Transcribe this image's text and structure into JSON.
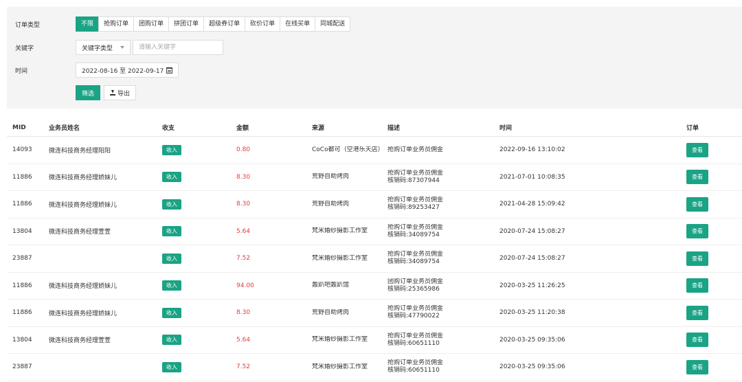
{
  "filters": {
    "order_type_label": "订单类型",
    "order_types": [
      "不限",
      "抢购订单",
      "团购订单",
      "拼团订单",
      "超级券订单",
      "砍价订单",
      "在线买单",
      "同城配送"
    ],
    "keyword_label": "关键字",
    "keyword_select": "关键字类型",
    "keyword_placeholder": "请输入关键字",
    "time_label": "时间",
    "date_range": "2022-08-16 至 2022-09-17",
    "filter_button": "筛选",
    "export_button": "导出"
  },
  "table": {
    "headers": [
      "MID",
      "业务员姓名",
      "收支",
      "金额",
      "来源",
      "描述",
      "时间",
      "订单"
    ],
    "view_label": "查看",
    "rows": [
      {
        "mid": "14093",
        "name": "微连科技商务经理阳阳",
        "type": "收入",
        "amount": "0.80",
        "source": "CoCo都可（空港乐天店）",
        "desc1": "抢购订单业务员佣金",
        "desc2": "",
        "time": "2022-09-16 13:10:02"
      },
      {
        "mid": "11886",
        "name": "微连科技商务经理娇妹儿",
        "type": "收入",
        "amount": "8.30",
        "source": "荒野自助烤肉",
        "desc1": "抢购订单业务员佣金",
        "desc2": "核销码:87307944",
        "time": "2021-07-01 10:08:35"
      },
      {
        "mid": "11886",
        "name": "微连科技商务经理娇妹儿",
        "type": "收入",
        "amount": "8.30",
        "source": "荒野自助烤肉",
        "desc1": "抢购订单业务员佣金",
        "desc2": "核销码:89253427",
        "time": "2021-04-28 15:09:42"
      },
      {
        "mid": "13804",
        "name": "微连科技商务经理萱萱",
        "type": "收入",
        "amount": "5.64",
        "source": "梵米婚纱摄影工作室",
        "desc1": "抢购订单业务员佣金",
        "desc2": "核销码:34089754",
        "time": "2020-07-24 15:08:27"
      },
      {
        "mid": "23887",
        "name": "",
        "type": "收入",
        "amount": "7.52",
        "source": "梵米婚纱摄影工作室",
        "desc1": "抢购订单业务员佣金",
        "desc2": "核销码:34089754",
        "time": "2020-07-24 15:08:27"
      },
      {
        "mid": "11886",
        "name": "微连科技商务经理娇妹儿",
        "type": "收入",
        "amount": "94.00",
        "source": "轰趴吧轰趴馆",
        "desc1": "团购订单业务员佣金",
        "desc2": "核销码:25365986",
        "time": "2020-03-25 11:26:25"
      },
      {
        "mid": "11886",
        "name": "微连科技商务经理娇妹儿",
        "type": "收入",
        "amount": "8.30",
        "source": "荒野自助烤肉",
        "desc1": "抢购订单业务员佣金",
        "desc2": "核销码:47790022",
        "time": "2020-03-25 11:20:38"
      },
      {
        "mid": "13804",
        "name": "微连科技商务经理萱萱",
        "type": "收入",
        "amount": "5.64",
        "source": "梵米婚纱摄影工作室",
        "desc1": "抢购订单业务员佣金",
        "desc2": "核销码:60651110",
        "time": "2020-03-25 09:35:06"
      },
      {
        "mid": "23887",
        "name": "",
        "type": "收入",
        "amount": "7.52",
        "source": "梵米婚纱摄影工作室",
        "desc1": "抢购订单业务员佣金",
        "desc2": "核销码:60651110",
        "time": "2020-03-25 09:35:06"
      }
    ]
  },
  "colors": {
    "accent": "#1aa385",
    "amount": "#e23b3b"
  },
  "icons": {
    "select_caret": "chevron-down-icon",
    "date": "calendar-icon",
    "export": "download-icon"
  }
}
